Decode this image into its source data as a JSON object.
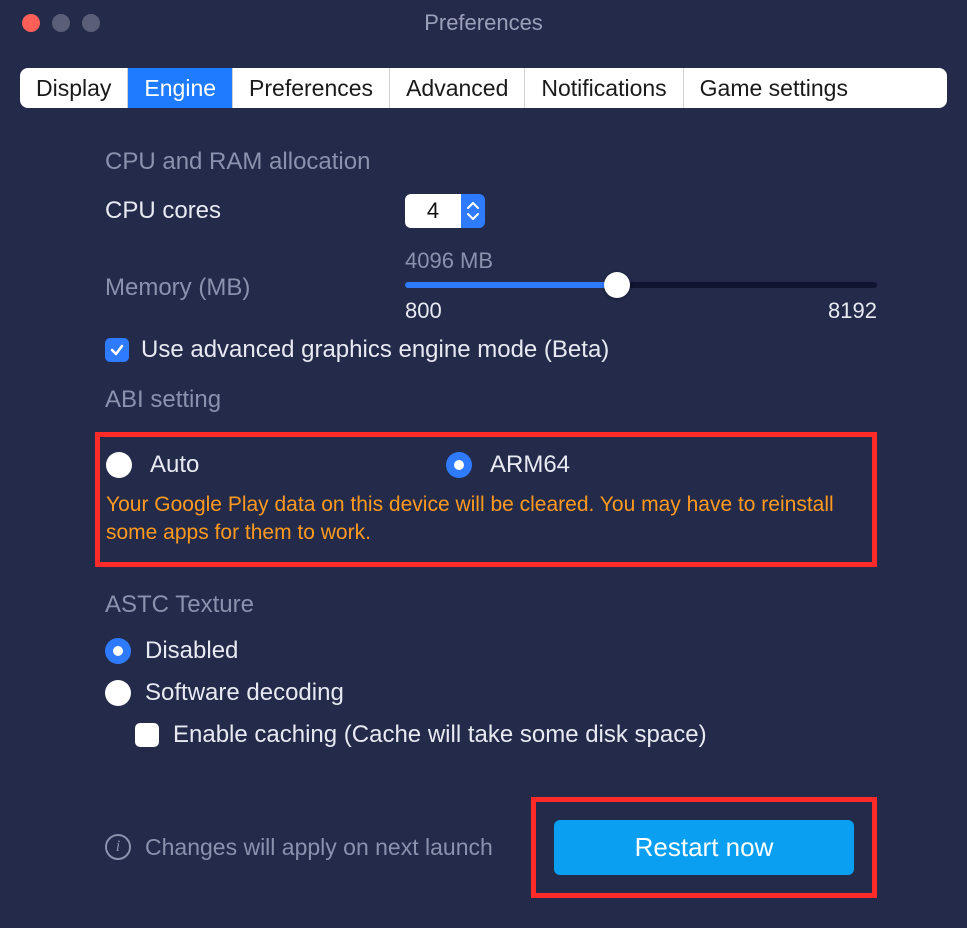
{
  "window": {
    "title": "Preferences"
  },
  "tabs": [
    {
      "label": "Display",
      "active": false
    },
    {
      "label": "Engine",
      "active": true
    },
    {
      "label": "Preferences",
      "active": false
    },
    {
      "label": "Advanced",
      "active": false
    },
    {
      "label": "Notifications",
      "active": false
    },
    {
      "label": "Game settings",
      "active": false
    }
  ],
  "cpu_ram": {
    "section_title": "CPU and RAM allocation",
    "cpu_label": "CPU cores",
    "cpu_value": "4",
    "memory_label": "Memory (MB)",
    "memory_current": "4096 MB",
    "memory_min": "800",
    "memory_max": "8192",
    "memory_fill_pct": 45
  },
  "adv_gfx": {
    "label": "Use advanced graphics engine mode (Beta)",
    "checked": true
  },
  "abi": {
    "section_title": "ABI setting",
    "options": [
      {
        "label": "Auto",
        "selected": false
      },
      {
        "label": "ARM64",
        "selected": true
      }
    ],
    "warning": "Your Google Play data on this device will be cleared. You may have to reinstall some apps for them to work."
  },
  "astc": {
    "section_title": "ASTC Texture",
    "options": [
      {
        "label": "Disabled",
        "selected": true
      },
      {
        "label": "Software decoding",
        "selected": false
      }
    ],
    "caching": {
      "label": "Enable caching (Cache will take some disk space)",
      "checked": false
    }
  },
  "footer": {
    "info": "Changes will apply on next launch",
    "restart_label": "Restart now"
  }
}
